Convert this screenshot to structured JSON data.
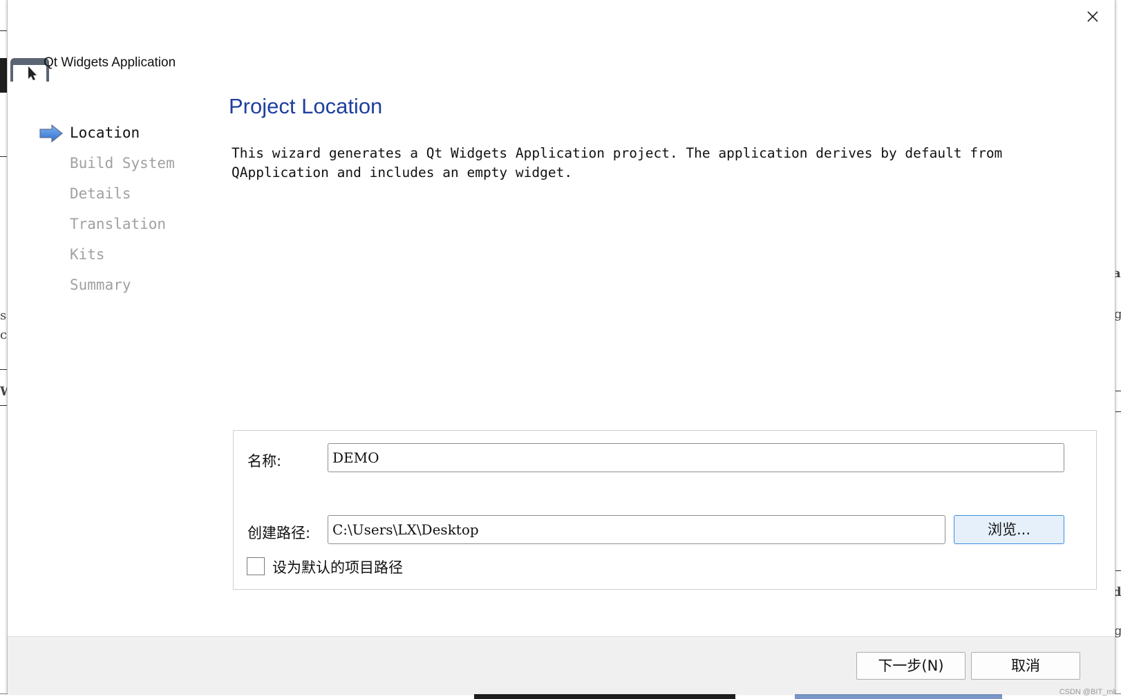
{
  "window": {
    "app_title": "Qt Widgets Application",
    "close_icon": "close-icon"
  },
  "steps": [
    {
      "label": "Location",
      "active": true
    },
    {
      "label": "Build System",
      "active": false
    },
    {
      "label": "Details",
      "active": false
    },
    {
      "label": "Translation",
      "active": false
    },
    {
      "label": "Kits",
      "active": false
    },
    {
      "label": "Summary",
      "active": false
    }
  ],
  "page": {
    "heading": "Project Location",
    "description": "This wizard generates a Qt Widgets Application project. The application derives by default from QApplication and includes an empty widget."
  },
  "form": {
    "name_label": "名称:",
    "name_value": "DEMO",
    "path_label": "创建路径:",
    "path_value": "C:\\Users\\LX\\Desktop",
    "browse_label": "浏览...",
    "default_checkbox_label": "设为默认的项目路径",
    "default_checkbox_checked": false
  },
  "footer": {
    "next_label": "下一步(N)",
    "cancel_label": "取消"
  },
  "background_fragments": [
    "s",
    "c",
    "W",
    "ar",
    "g",
    "di",
    "g"
  ],
  "watermark": "CSDN @BIT_mk",
  "colors": {
    "heading": "#1f3fa0",
    "active_step": "#111111",
    "inactive_step": "#a0a0a0",
    "browse_border": "#3c8ce0"
  }
}
